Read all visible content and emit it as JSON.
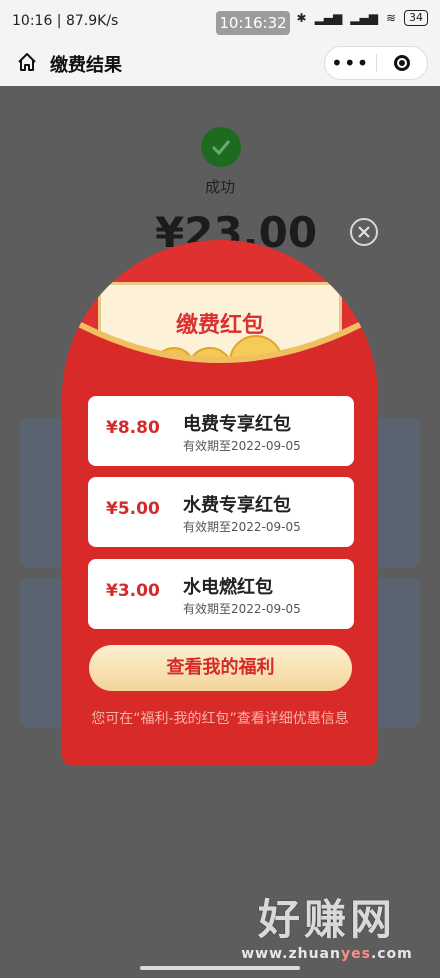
{
  "status_bar": {
    "time": "10:16",
    "network_speed": "87.9K/s",
    "center_time": "10:16:32",
    "battery": "34"
  },
  "nav": {
    "title": "缴费结果",
    "more_label": "•••"
  },
  "payment": {
    "status": "成功",
    "amount": "¥23.00"
  },
  "red_packet": {
    "title": "缴费红包",
    "coupons": [
      {
        "amount": "¥8.80",
        "title": "电费专享红包",
        "expiry": "有效期至2022-09-05"
      },
      {
        "amount": "¥5.00",
        "title": "水费专享红包",
        "expiry": "有效期至2022-09-05"
      },
      {
        "amount": "¥3.00",
        "title": "水电燃红包",
        "expiry": "有效期至2022-09-05"
      }
    ],
    "button_label": "查看我的福利",
    "hint": "您可在“福利-我的红包”查看详细优惠信息"
  },
  "watermark": {
    "brand": "好赚网",
    "url_prefix": "www.zhuan",
    "url_accent": "yes",
    "url_suffix": ".com"
  },
  "colors": {
    "envelope_red": "#d92a2a",
    "coupon_red": "#d42a2a",
    "success_green": "#1e6a1e",
    "overlay": "#5d5d5d"
  }
}
